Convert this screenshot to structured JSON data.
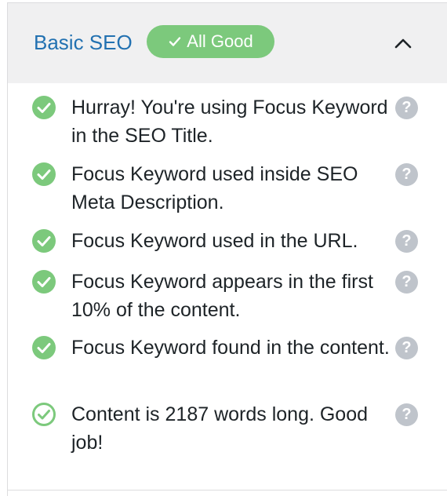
{
  "section": {
    "title": "Basic SEO",
    "badge_label": "All Good",
    "colors": {
      "title": "#2271b1",
      "badge": "#7cc97c",
      "pass": "#7cc97c",
      "help": "#bfc4cb"
    }
  },
  "items": [
    {
      "text": "Hurray! You're using Focus Keyword in the SEO Title.",
      "status_icon": "check-circle-filled",
      "help": "?"
    },
    {
      "text": "Focus Keyword used inside SEO Meta Description.",
      "status_icon": "check-circle-filled",
      "help": "?"
    },
    {
      "text": "Focus Keyword used in the URL.",
      "status_icon": "check-circle-filled",
      "help": "?"
    },
    {
      "text": "Focus Keyword appears in the first 10% of the content.",
      "status_icon": "check-circle-filled",
      "help": "?"
    },
    {
      "text": "Focus Keyword found in the content.",
      "status_icon": "check-circle-filled",
      "help": "?"
    },
    {
      "text": "Content is 2187 words long. Good job!",
      "status_icon": "check-circle-outline",
      "help": "?"
    }
  ]
}
